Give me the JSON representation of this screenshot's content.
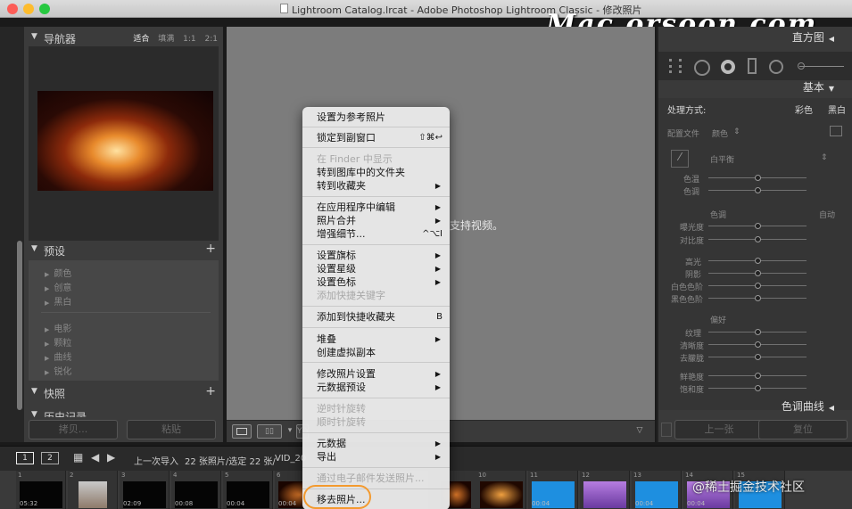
{
  "window": {
    "title": "Lightroom Catalog.lrcat - Adobe Photoshop Lightroom Classic - 修改照片",
    "watermark": "Mac.orsoon.com"
  },
  "left_panel": {
    "navigator": {
      "title": "导航器",
      "zoom_options": [
        "适合",
        "填满",
        "1:1",
        "2:1"
      ],
      "selected_zoom": "适合"
    },
    "presets": {
      "title": "预设",
      "items": [
        "颜色",
        "创意",
        "黑白",
        "电影",
        "颗粒",
        "曲线",
        "锐化"
      ]
    },
    "snapshots": {
      "title": "快照"
    },
    "history": {
      "title": "历史记录"
    },
    "buttons": {
      "copy": "拷贝...",
      "paste": "粘贴"
    }
  },
  "center": {
    "message": "支持视频。",
    "toolbar": {
      "view_label": "Y|Y"
    }
  },
  "right_panel": {
    "histogram": "直方图",
    "basic": "基本",
    "treatment_label": "处理方式:",
    "treatment_color": "彩色",
    "treatment_bw": "黑白",
    "profile_label": "配置文件",
    "profile_value": "颜色",
    "wb_label": "白平衡",
    "wb_sliders": [
      "色温",
      "色调"
    ],
    "tone_label": "色调",
    "tone_auto": "自动",
    "tone_sliders": [
      "曝光度",
      "对比度",
      "高光",
      "阴影",
      "白色色阶",
      "黑色色阶"
    ],
    "presence_label": "偏好",
    "presence_sliders": [
      "纹理",
      "清晰度",
      "去朦胧",
      "鲜艳度",
      "饱和度"
    ],
    "tone_curve": "色调曲线",
    "buttons": {
      "previous": "上一张",
      "reset": "复位"
    }
  },
  "filmstrip": {
    "screens": [
      "1",
      "2"
    ],
    "source_text": "上一次导入",
    "count_text": "22 张照片/选定 22 张/",
    "file_text": "VID_20",
    "cells": [
      {
        "index": "1",
        "time": "05:32"
      },
      {
        "index": "2",
        "time": ""
      },
      {
        "index": "3",
        "time": "02:09"
      },
      {
        "index": "4",
        "time": "00:08"
      },
      {
        "index": "5",
        "time": "00:04"
      },
      {
        "index": "6",
        "time": "00:04"
      },
      {
        "index": "10",
        "time": ""
      },
      {
        "index": "11",
        "time": "00:04"
      },
      {
        "index": "12",
        "time": ""
      },
      {
        "index": "13",
        "time": "00:04"
      },
      {
        "index": "14",
        "time": "00:04"
      },
      {
        "index": "15",
        "time": ""
      }
    ],
    "overlay_watermark": "@稀土掘金技术社区"
  },
  "context_menu": {
    "groups": [
      [
        {
          "label": "设置为参考照片",
          "enabled": true
        }
      ],
      [
        {
          "label": "锁定到副窗口",
          "enabled": true,
          "shortcut": "⇧⌘↩"
        }
      ],
      [
        {
          "label": "在 Finder 中显示",
          "enabled": false
        },
        {
          "label": "转到图库中的文件夹",
          "enabled": true
        },
        {
          "label": "转到收藏夹",
          "enabled": true,
          "submenu": true
        }
      ],
      [
        {
          "label": "在应用程序中编辑",
          "enabled": true,
          "submenu": true
        },
        {
          "label": "照片合并",
          "enabled": true,
          "submenu": true
        },
        {
          "label": "增强细节...",
          "enabled": true,
          "shortcut": "^⌥I"
        }
      ],
      [
        {
          "label": "设置旗标",
          "enabled": true,
          "submenu": true
        },
        {
          "label": "设置星级",
          "enabled": true,
          "submenu": true
        },
        {
          "label": "设置色标",
          "enabled": true,
          "submenu": true
        },
        {
          "label": "添加快捷关键字",
          "enabled": false
        }
      ],
      [
        {
          "label": "添加到快捷收藏夹",
          "enabled": true,
          "shortcut": "B"
        }
      ],
      [
        {
          "label": "堆叠",
          "enabled": true,
          "submenu": true
        },
        {
          "label": "创建虚拟副本",
          "enabled": true
        }
      ],
      [
        {
          "label": "修改照片设置",
          "enabled": true,
          "submenu": true
        },
        {
          "label": "元数据预设",
          "enabled": true,
          "submenu": true
        }
      ],
      [
        {
          "label": "逆时针旋转",
          "enabled": false
        },
        {
          "label": "顺时针旋转",
          "enabled": false
        }
      ],
      [
        {
          "label": "元数据",
          "enabled": true,
          "submenu": true
        },
        {
          "label": "导出",
          "enabled": true,
          "submenu": true
        }
      ],
      [
        {
          "label": "通过电子邮件发送照片...",
          "enabled": false
        }
      ],
      [
        {
          "label": "移去照片...",
          "enabled": true
        }
      ]
    ],
    "highlight_color": "#f39a2f"
  }
}
